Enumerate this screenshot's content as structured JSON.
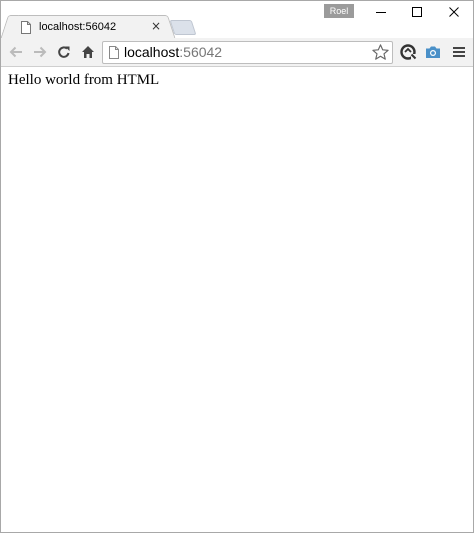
{
  "window": {
    "profile_name": "Roel"
  },
  "tab": {
    "title": "localhost:56042",
    "close_glyph": "×"
  },
  "toolbar": {
    "url_host": "localhost",
    "url_port": ":56042"
  },
  "page": {
    "body_text": "Hello world from HTML"
  },
  "icons": {
    "tab_favicon": "page-icon",
    "back": "arrow-left-icon",
    "forward": "arrow-right-icon",
    "reload": "reload-icon",
    "home": "home-icon",
    "bookmark": "star-icon",
    "extension_1": "sync-icon",
    "extension_2": "camera-icon",
    "menu": "hamburger-icon"
  },
  "colors": {
    "toolbar_bg": "#f2f2f2",
    "camera_icon": "#4a90c8",
    "profile_badge": "#9b9b9b"
  }
}
